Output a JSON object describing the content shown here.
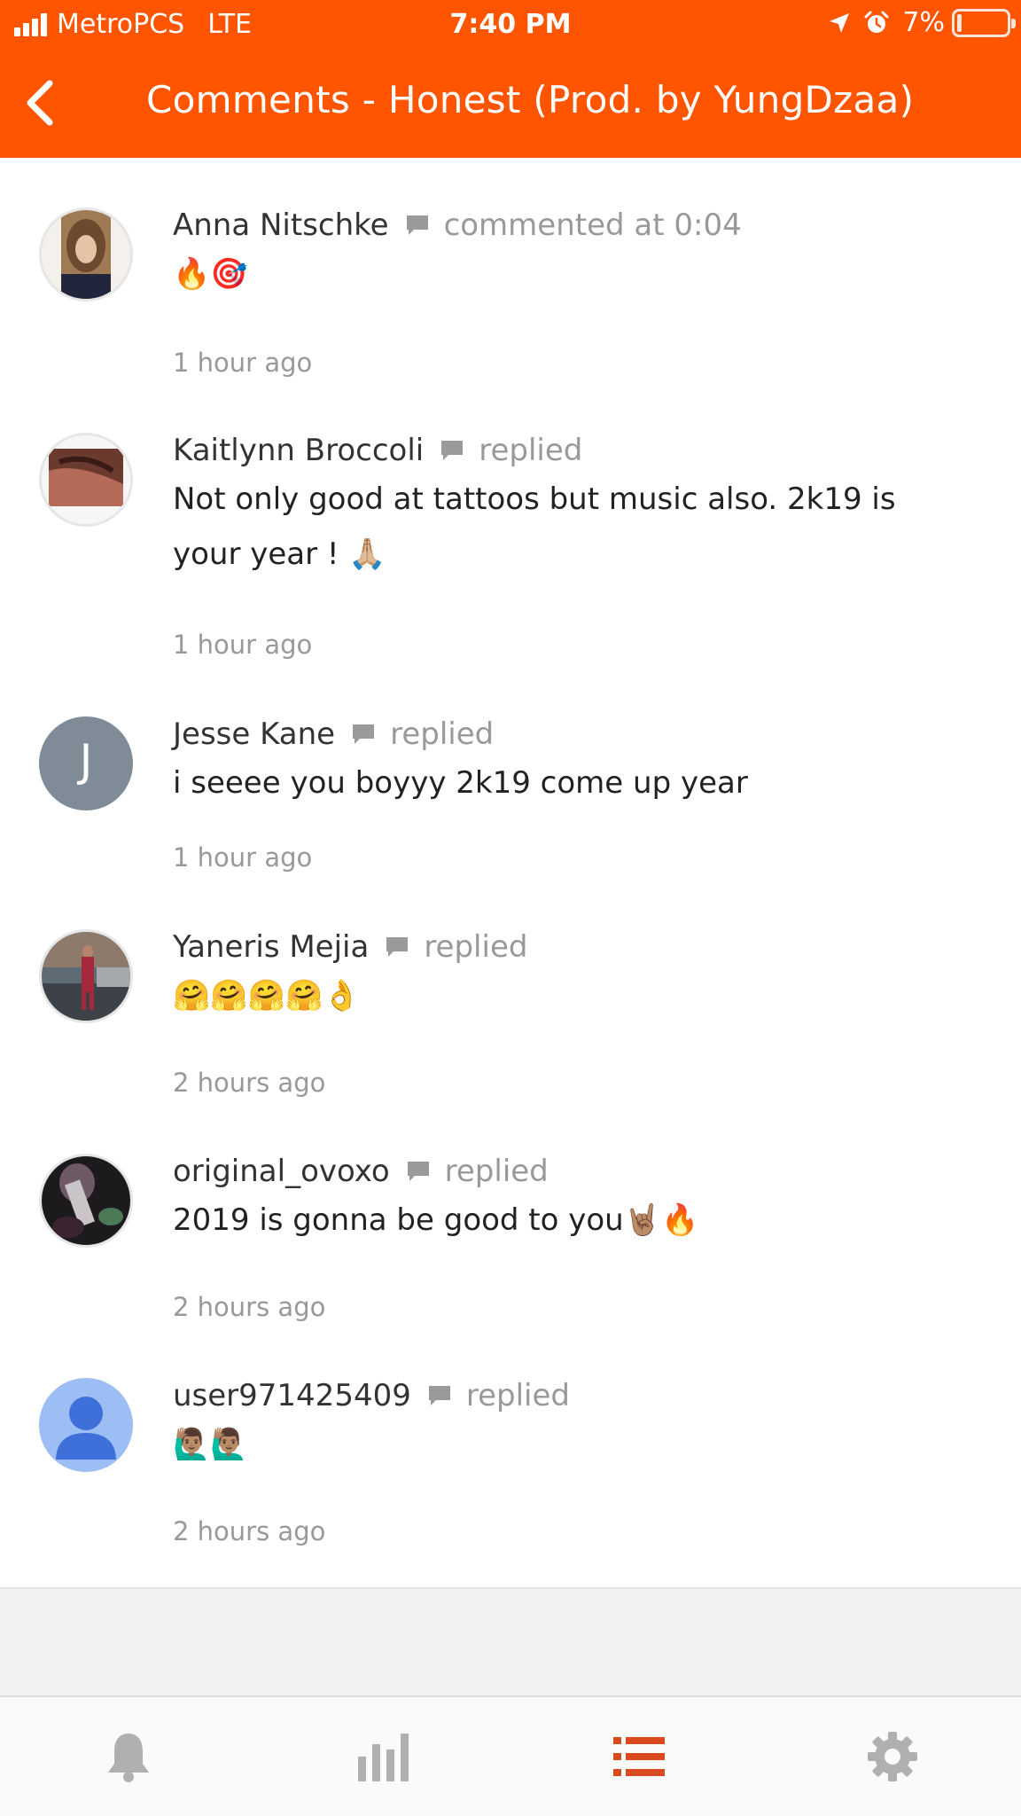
{
  "status_bar": {
    "carrier": "MetroPCS",
    "network": "LTE",
    "time": "7:40 PM",
    "battery_percent": "7%",
    "battery_level": 0.07,
    "icons": [
      "signal-icon",
      "location-arrow-icon",
      "alarm-clock-icon",
      "battery-icon"
    ]
  },
  "header": {
    "back_icon": "chevron-left-icon",
    "title": "Comments - Honest (Prod. by YungDzaa)",
    "background_color": "#ff5500"
  },
  "comments": [
    {
      "user": "Anna Nitschke",
      "action": "commented at 0:04",
      "text": "🔥🎯",
      "time": "1 hour ago",
      "avatar": "photo"
    },
    {
      "user": "Kaitlynn Broccoli",
      "action": "replied",
      "text": "Not only good at tattoos but music also. 2k19 is your year ! 🙏🏼",
      "time": "1 hour ago",
      "avatar": "photo"
    },
    {
      "user": "Jesse Kane",
      "action": "replied",
      "text": "i seeee you boyyy 2k19 come up year",
      "time": "1 hour ago",
      "avatar": "letter",
      "avatar_letter": "J"
    },
    {
      "user": "Yaneris Mejia",
      "action": "replied",
      "text": "🤗🤗🤗🤗👌",
      "time": "2 hours ago",
      "avatar": "photo"
    },
    {
      "user": "original_ovoxo",
      "action": "replied",
      "text": "2019 is gonna be good to you🤘🏽🔥",
      "time": "2 hours ago",
      "avatar": "photo"
    },
    {
      "user": "user971425409",
      "action": "replied",
      "text": "🙋🏽‍♂️🙋🏽‍♂️",
      "time": "2 hours ago",
      "avatar": "default"
    }
  ],
  "tab_bar": {
    "tabs": [
      {
        "icon": "bell-icon",
        "active": false
      },
      {
        "icon": "stats-bars-icon",
        "active": false
      },
      {
        "icon": "list-icon",
        "active": true
      },
      {
        "icon": "gear-icon",
        "active": false
      }
    ],
    "active_color": "#d94a1e",
    "inactive_color": "#b0b0b0"
  }
}
